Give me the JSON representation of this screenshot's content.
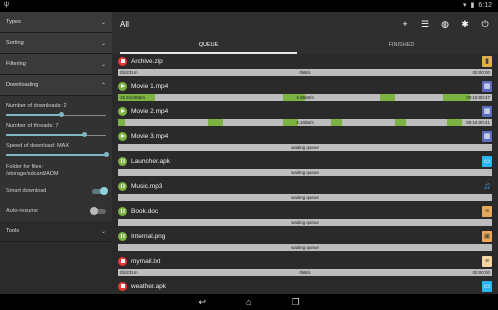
{
  "status": {
    "time": "6:12"
  },
  "drawer": {
    "sections": {
      "types": "Types",
      "sorting": "Sorting",
      "filtering": "Filtering",
      "downloading": "Downloading",
      "tools": "Tools"
    },
    "downloading": {
      "num_downloads_label": "Number of downloads: 2",
      "num_downloads_level": 0.55,
      "num_threads_label": "Number of threads: 7",
      "num_threads_level": 0.78,
      "speed_label": "Speed of download: MAX",
      "speed_level": 1.0,
      "folder_label": "Folder for files:",
      "folder_value": "/storage/sdcard/ADM"
    },
    "toggles": {
      "smart_download": "Smart download",
      "auto_resume": "Auto-resume"
    }
  },
  "appbar": {
    "title": "All"
  },
  "tabs": [
    "QUEUE",
    "FINISHED"
  ],
  "downloads": [
    {
      "name": "Archive.zip",
      "state": "stopped",
      "type": "zip",
      "left": "0b/231m",
      "center": "0kB/s",
      "right": "00:00:00",
      "segments": []
    },
    {
      "name": "Movie 1.mp4",
      "state": "playing",
      "type": "video",
      "left": "15.5m/256m",
      "center": "4.36kB/s",
      "right": "00:16:00:47",
      "segments": [
        [
          0,
          0.1
        ],
        [
          0.44,
          0.5
        ],
        [
          0.7,
          0.74
        ],
        [
          0.87,
          0.94
        ]
      ]
    },
    {
      "name": "Movie 2.mp4",
      "state": "playing",
      "type": "video",
      "left": "",
      "center": "4.16kB/s",
      "right": "00:15:00:41",
      "segments": [
        [
          0,
          0.02
        ],
        [
          0.24,
          0.28
        ],
        [
          0.44,
          0.48
        ],
        [
          0.57,
          0.6
        ],
        [
          0.74,
          0.77
        ],
        [
          0.88,
          0.92
        ]
      ]
    },
    {
      "name": "Movie 3.mp4",
      "state": "playing",
      "type": "video",
      "left": "",
      "center": "waiting queue",
      "right": "",
      "segments": []
    },
    {
      "name": "Launcher.apk",
      "state": "paused",
      "type": "app",
      "left": "",
      "center": "waiting queue",
      "right": "",
      "segments": []
    },
    {
      "name": "Music.mp3",
      "state": "paused",
      "type": "music",
      "left": "",
      "center": "waiting queue",
      "right": "",
      "segments": []
    },
    {
      "name": "Book.doc",
      "state": "paused",
      "type": "doc",
      "left": "",
      "center": "waiting queue",
      "right": "",
      "segments": []
    },
    {
      "name": "Internal.png",
      "state": "paused",
      "type": "img",
      "left": "",
      "center": "waiting queue",
      "right": "",
      "segments": []
    },
    {
      "name": "mymail.txt",
      "state": "stopped",
      "type": "txt",
      "left": "0b/231m",
      "center": "0kB/s",
      "right": "00:00:00",
      "segments": []
    },
    {
      "name": "weather.apk",
      "state": "stopped",
      "type": "app",
      "left": "",
      "center": "",
      "right": "",
      "segments": []
    }
  ]
}
